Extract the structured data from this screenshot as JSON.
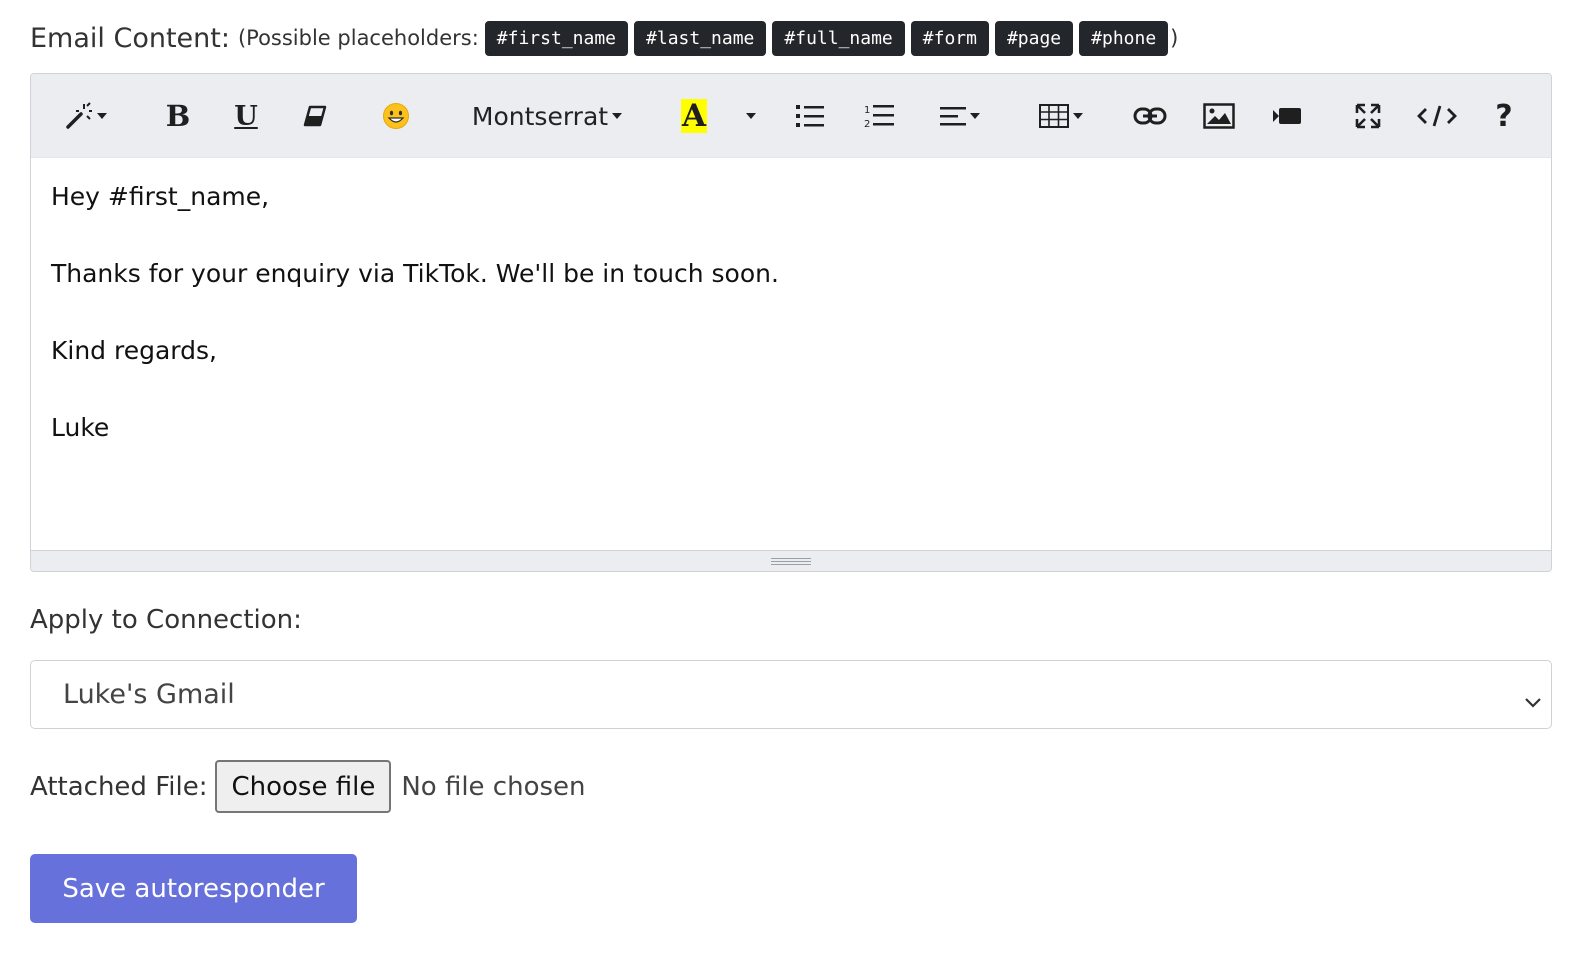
{
  "email_content": {
    "label": "Email Content:",
    "hint_prefix": "(Possible placeholders:",
    "hint_suffix": ")",
    "placeholders": [
      "#first_name",
      "#last_name",
      "#full_name",
      "#form",
      "#page",
      "#phone"
    ]
  },
  "toolbar": {
    "font_name": "Montserrat",
    "highlight_color": "#ffff00",
    "highlight_letter": "A",
    "icons": [
      "magic-icon",
      "bold-icon",
      "underline-icon",
      "eraser-icon",
      "emoji-icon",
      "font-dropdown",
      "highlight-icon",
      "color-caret",
      "bullet-list-icon",
      "numbered-list-icon",
      "align-icon",
      "table-icon",
      "link-icon",
      "image-icon",
      "video-icon",
      "fullscreen-icon",
      "code-icon",
      "help-icon"
    ]
  },
  "editor": {
    "lines": [
      "Hey #first_name,",
      "Thanks for your enquiry via TikTok. We'll be in touch soon.",
      "Kind regards,",
      "Luke"
    ]
  },
  "connection": {
    "label": "Apply to Connection:",
    "selected": "Luke's Gmail"
  },
  "attachment": {
    "label": "Attached File:",
    "button_label": "Choose file",
    "status": "No file chosen"
  },
  "save": {
    "label": "Save autoresponder",
    "color": "#6771dc"
  }
}
